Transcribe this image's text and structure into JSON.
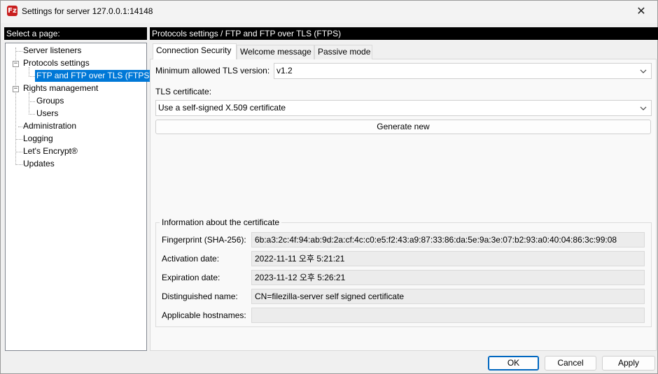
{
  "window": {
    "title": "Settings for server 127.0.0.1:14148",
    "icon_text": "Fz",
    "close_glyph": "✕"
  },
  "nav": {
    "header": "Select a page:",
    "items": [
      {
        "label": "Server listeners",
        "expander": ""
      },
      {
        "label": "Protocols settings",
        "expander": "−"
      },
      {
        "label": "FTP and FTP over TLS (FTPS)",
        "expander": ""
      },
      {
        "label": "Rights management",
        "expander": "−"
      },
      {
        "label": "Groups",
        "expander": ""
      },
      {
        "label": "Users",
        "expander": ""
      },
      {
        "label": "Administration",
        "expander": ""
      },
      {
        "label": "Logging",
        "expander": ""
      },
      {
        "label": "Let's Encrypt®",
        "expander": ""
      },
      {
        "label": "Updates",
        "expander": ""
      }
    ]
  },
  "panel": {
    "header": "Protocols settings / FTP and FTP over TLS (FTPS)",
    "tabs": [
      "Connection Security",
      "Welcome message",
      "Passive mode"
    ],
    "min_tls_label": "Minimum allowed TLS version:",
    "min_tls_value": "v1.2",
    "tls_cert_label": "TLS certificate:",
    "tls_cert_value": "Use a self-signed X.509 certificate",
    "generate_button": "Generate new",
    "cert_info": {
      "title": "Information about the certificate",
      "rows": [
        {
          "label": "Fingerprint (SHA-256):",
          "value": "6b:a3:2c:4f:94:ab:9d:2a:cf:4c:c0:e5:f2:43:a9:87:33:86:da:5e:9a:3e:07:b2:93:a0:40:04:86:3c:99:08"
        },
        {
          "label": "Activation date:",
          "value": "2022-11-11 오후 5:21:21"
        },
        {
          "label": "Expiration date:",
          "value": "2023-11-12 오후 5:26:21"
        },
        {
          "label": "Distinguished name:",
          "value": "CN=filezilla-server self signed certificate"
        },
        {
          "label": "Applicable hostnames:",
          "value": ""
        }
      ]
    }
  },
  "footer": {
    "ok": "OK",
    "cancel": "Cancel",
    "apply": "Apply"
  },
  "colors": {
    "selection": "#0078d7",
    "header_bg": "#000000",
    "default_button_border": "#0067c0"
  }
}
